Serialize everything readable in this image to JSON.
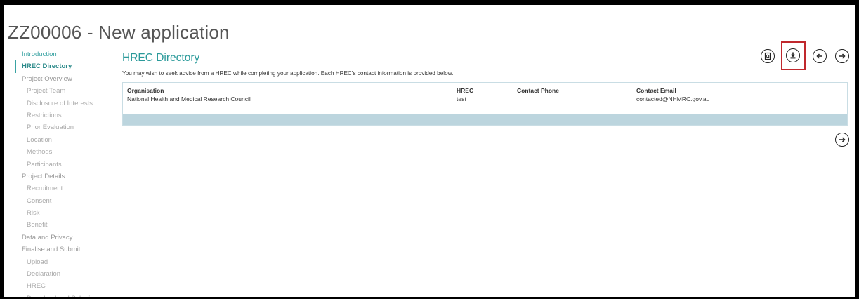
{
  "app": {
    "title": "ZZ00006 - New application"
  },
  "sidebar": {
    "items": [
      {
        "label": "Introduction",
        "level": 1,
        "state": "visited"
      },
      {
        "label": "HREC Directory",
        "level": 1,
        "state": "active"
      },
      {
        "label": "Project Overview",
        "level": 1,
        "state": ""
      },
      {
        "label": "Project Team",
        "level": 2,
        "state": ""
      },
      {
        "label": "Disclosure of Interests",
        "level": 2,
        "state": ""
      },
      {
        "label": "Restrictions",
        "level": 2,
        "state": ""
      },
      {
        "label": "Prior Evaluation",
        "level": 2,
        "state": ""
      },
      {
        "label": "Location",
        "level": 2,
        "state": ""
      },
      {
        "label": "Methods",
        "level": 2,
        "state": ""
      },
      {
        "label": "Participants",
        "level": 2,
        "state": ""
      },
      {
        "label": "Project Details",
        "level": 1,
        "state": ""
      },
      {
        "label": "Recruitment",
        "level": 2,
        "state": ""
      },
      {
        "label": "Consent",
        "level": 2,
        "state": ""
      },
      {
        "label": "Risk",
        "level": 2,
        "state": ""
      },
      {
        "label": "Benefit",
        "level": 2,
        "state": ""
      },
      {
        "label": "Data and Privacy",
        "level": 1,
        "state": ""
      },
      {
        "label": "Finalise and Submit",
        "level": 1,
        "state": ""
      },
      {
        "label": "Upload",
        "level": 2,
        "state": ""
      },
      {
        "label": "Declaration",
        "level": 2,
        "state": ""
      },
      {
        "label": "HREC",
        "level": 2,
        "state": ""
      },
      {
        "label": "Download and Submit",
        "level": 2,
        "state": ""
      }
    ]
  },
  "main": {
    "title": "HREC Directory",
    "intro": "You may wish to seek advice from a HREC while completing your application. Each HREC's contact information is provided below.",
    "table": {
      "headers": [
        "Organisation",
        "HREC",
        "Contact Phone",
        "Contact Email"
      ],
      "rows": [
        [
          "National Health and Medical Research Council",
          "test",
          "",
          "contacted@NHMRC.gov.au"
        ]
      ]
    }
  },
  "toolbar": {
    "icons": [
      "preview-document-icon",
      "download-icon",
      "previous-arrow-icon",
      "next-arrow-icon"
    ]
  },
  "colors": {
    "accent": "#2b9a9a",
    "table_footer": "#bcd5de",
    "highlight": "#c0282d"
  }
}
